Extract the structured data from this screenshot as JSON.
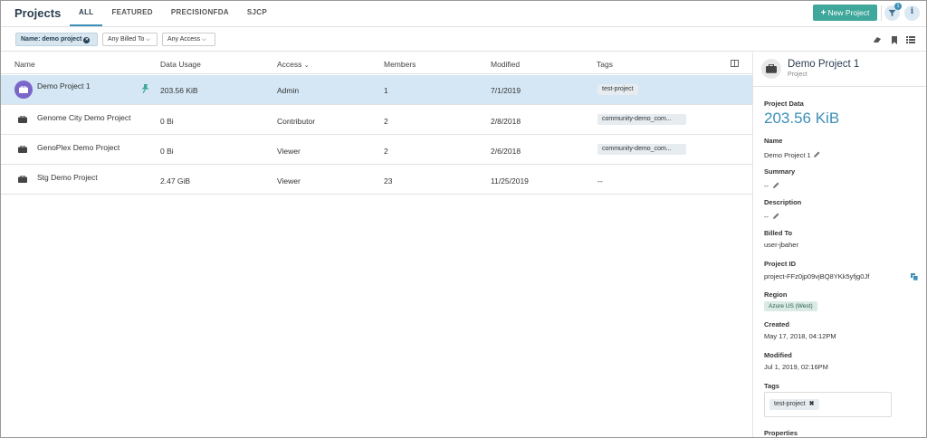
{
  "header": {
    "title": "Projects",
    "tabs": [
      {
        "label": "ALL",
        "active": true
      },
      {
        "label": "FEATURED",
        "active": false
      },
      {
        "label": "PRECISIONFDA",
        "active": false
      },
      {
        "label": "SJCP",
        "active": false
      }
    ],
    "new_project_label": "New Project",
    "filter_badge_count": "1",
    "accent_color": "#3fa79b",
    "icons": [
      "plus-icon",
      "filter-icon",
      "info-icon"
    ]
  },
  "filters": {
    "name_filter": "Name: demo project",
    "billed_to": "Any Billed To",
    "access": "Any Access",
    "icons": [
      "eraser-icon",
      "bookmark-icon",
      "list-view-icon"
    ]
  },
  "table": {
    "columns": {
      "name": "Name",
      "data_usage": "Data Usage",
      "access": "Access",
      "members": "Members",
      "modified": "Modified",
      "tags": "Tags"
    },
    "rows": [
      {
        "name": "Demo Project 1",
        "data_usage": "203.56 KiB",
        "access": "Admin",
        "members": "1",
        "modified": "7/1/2019",
        "tags": "test-project",
        "selected": true,
        "pinned": true
      },
      {
        "name": "Genome City Demo Project",
        "data_usage": "0 Bi",
        "access": "Contributor",
        "members": "2",
        "modified": "2/8/2018",
        "tags": "community-demo_com...",
        "selected": false,
        "pinned": false
      },
      {
        "name": "GenoPlex Demo Project",
        "data_usage": "0 Bi",
        "access": "Viewer",
        "members": "2",
        "modified": "2/6/2018",
        "tags": "community-demo_com...",
        "selected": false,
        "pinned": false
      },
      {
        "name": "Stg Demo Project",
        "data_usage": "2.47 GiB",
        "access": "Viewer",
        "members": "23",
        "modified": "11/25/2019",
        "tags": "--",
        "selected": false,
        "pinned": false
      }
    ],
    "selected_color": "#d5e7f5"
  },
  "panel": {
    "title": "Demo Project 1",
    "subtitle": "Project",
    "project_data_label": "Project Data",
    "project_data_value": "203.56 KiB",
    "name_label": "Name",
    "name_value": "Demo Project 1",
    "summary_label": "Summary",
    "summary_value": "--",
    "description_label": "Description",
    "description_value": "--",
    "billed_to_label": "Billed To",
    "billed_to_value": "user-jbaher",
    "project_id_label": "Project ID",
    "project_id_value": "project-FFz0jp09vjBQ8YKk5yfjg0Jf",
    "region_label": "Region",
    "region_value": "Azure US (West)",
    "created_label": "Created",
    "created_value": "May 17, 2018, 04:12PM",
    "modified_label": "Modified",
    "modified_value": "Jul 1, 2019, 02:16PM",
    "tags_label": "Tags",
    "tags": [
      "test-project"
    ],
    "tag_remove_glyph": "✖",
    "properties_label": "Properties"
  }
}
